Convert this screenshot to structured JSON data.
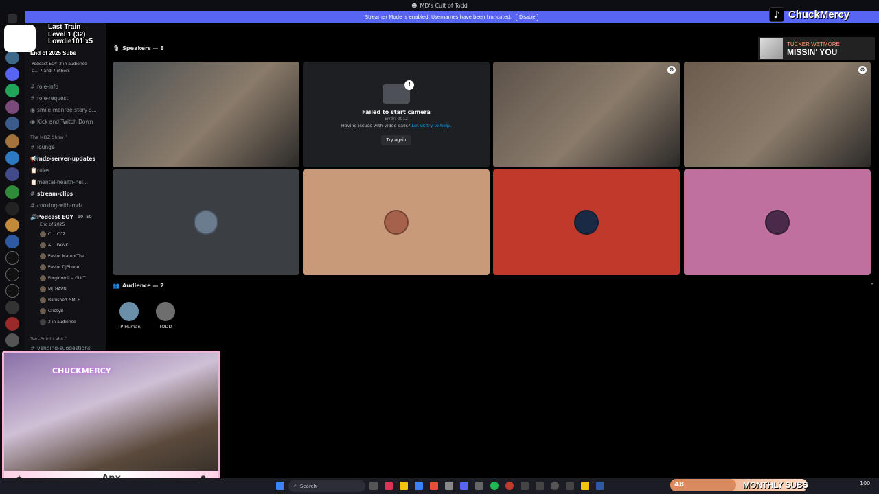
{
  "window": {
    "title": "MD's Cult of Todd"
  },
  "banner": {
    "text": "Streamer Mode is enabled. Usernames have been truncated.",
    "disable_label": "Disable"
  },
  "channels": [
    {
      "label": "role-info",
      "type": "text",
      "bold": false
    },
    {
      "label": "role-request",
      "type": "text",
      "bold": false
    },
    {
      "label": "smile-monroe-story-s...",
      "type": "text",
      "bold": false
    },
    {
      "label": "Kick and Twitch Down",
      "type": "text",
      "bold": false
    }
  ],
  "category_mdz": "The MDZ Show",
  "channels_mdz": [
    {
      "label": "lounge",
      "bold": false
    },
    {
      "label": "mdz-server-updates",
      "bold": true
    },
    {
      "label": "rules",
      "bold": false
    },
    {
      "label": "mental-health-hel...",
      "bold": false
    },
    {
      "label": "stream-clips",
      "bold": true
    },
    {
      "label": "cooking-with-mdz",
      "bold": false
    }
  ],
  "voice_channel": {
    "name": "Podcast EOY",
    "subtitle": "End of 2025",
    "count_a": "10",
    "count_b": "50"
  },
  "top_voice": {
    "name": "Podcast EOY",
    "sub": "2 in audience",
    "others": "C... 7 and 7 others"
  },
  "voice_users": [
    {
      "name": "C...",
      "badge": "CCZ"
    },
    {
      "name": "A...",
      "badge": "FAWK"
    },
    {
      "name": "Pastor Mateo(The...",
      "badge": ""
    },
    {
      "name": "Pastor DjPhone",
      "badge": ""
    },
    {
      "name": "Furginomics",
      "badge": "GULT"
    },
    {
      "name": "MJ",
      "badge": "HAVN"
    },
    {
      "name": "Banished",
      "badge": "SMLE"
    },
    {
      "name": "CrissyB",
      "badge": ""
    },
    {
      "name": "2 in audience",
      "badge": ""
    }
  ],
  "category_two_point": "Two-Point Labs",
  "channel_vending": "vending-suggestions",
  "stage": {
    "speakers_label": "Speakers — 8",
    "audience_label": "Audience — 2",
    "camera_error": {
      "title": "Failed to start camera",
      "code": "Error: 2012",
      "help_prefix": "Having issues with video calls?",
      "help_link": "Let us try to help.",
      "retry": "Try again"
    },
    "tiles": [
      {
        "kind": "video",
        "color": "#4a4f52",
        "speaking": false
      },
      {
        "kind": "error",
        "color": "#1e1f22",
        "speaking": false
      },
      {
        "kind": "video",
        "color": "#5b514a",
        "speaking": false
      },
      {
        "kind": "video",
        "color": "#6b5b4e",
        "speaking": false
      },
      {
        "kind": "avatar",
        "color": "#3b3e42",
        "avatar": "#6a7c8e"
      },
      {
        "kind": "avatar",
        "color": "#c99a7a",
        "avatar": "#a5614a"
      },
      {
        "kind": "avatar",
        "color": "#c0392b",
        "avatar": "#1b2a44"
      },
      {
        "kind": "avatar",
        "color": "#c0709f",
        "avatar": "#4a2a4a"
      }
    ],
    "audience": [
      {
        "name": "TP Human",
        "color": "#6b8fa8"
      },
      {
        "name": "TODD",
        "color": "#6e6e6e"
      }
    ]
  },
  "overlay": {
    "goal_lines": [
      "Last Train",
      "Level 1  (32)",
      "Lowdie101 x5",
      "End of 2025",
      "Subs"
    ],
    "tiktok_name": "ChuckMercy",
    "now_playing_artist": "TUCKER WETMORE",
    "now_playing_song": "MISSIN' YOU",
    "webcam_neon": "CHUCKMERCY",
    "webcam_bar_text": "Anx",
    "subs_count": "48",
    "subs_label": "MONTHLY SUBS",
    "subs_progress": 0.48
  },
  "taskbar": {
    "search_placeholder": "Search",
    "tray_value": "100"
  }
}
